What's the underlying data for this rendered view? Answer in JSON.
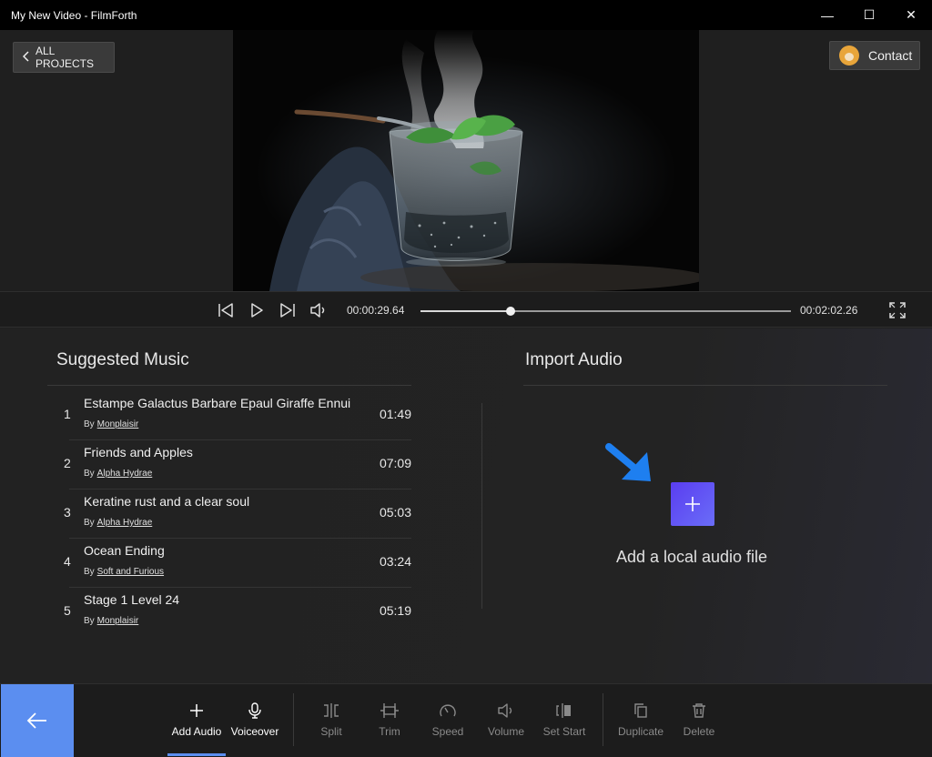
{
  "window": {
    "title": "My New Video - FilmForth",
    "minimize_glyph": "—",
    "maximize_glyph": "☐",
    "close_glyph": "✕"
  },
  "preview": {
    "back_label": "ALL PROJECTS",
    "contact_label": "Contact"
  },
  "playback": {
    "current_time": "00:00:29.64",
    "total_time": "00:02:02.26",
    "progress": 0.2424
  },
  "suggested_music": {
    "title": "Suggested Music",
    "by_prefix": "By",
    "tracks": [
      {
        "num": "1",
        "name": "Estampe Galactus Barbare Epaul Giraffe Ennui",
        "artist": "Monplaisir",
        "duration": "01:49"
      },
      {
        "num": "2",
        "name": "Friends and Apples",
        "artist": "Alpha Hydrae",
        "duration": "07:09"
      },
      {
        "num": "3",
        "name": "Keratine rust and a clear soul",
        "artist": "Alpha Hydrae",
        "duration": "05:03"
      },
      {
        "num": "4",
        "name": "Ocean Ending",
        "artist": "Soft and Furious",
        "duration": "03:24"
      },
      {
        "num": "5",
        "name": "Stage 1 Level 24",
        "artist": "Monplaisir",
        "duration": "05:19"
      }
    ]
  },
  "import_audio": {
    "title": "Import Audio",
    "add_label": "Add a local audio file"
  },
  "toolbar": {
    "add_audio": "Add Audio",
    "voiceover": "Voiceover",
    "split": "Split",
    "trim": "Trim",
    "speed": "Speed",
    "volume": "Volume",
    "set_start": "Set Start",
    "duplicate": "Duplicate",
    "delete": "Delete"
  },
  "colors": {
    "accent": "#5b8ef0",
    "add_button": "#6350f2",
    "hint_arrow": "#1e7ff0"
  }
}
